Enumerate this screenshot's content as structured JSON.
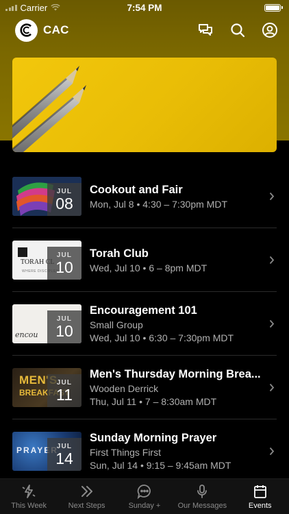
{
  "status_bar": {
    "carrier": "Carrier",
    "time": "7:54 PM"
  },
  "app_bar": {
    "title": "CAC"
  },
  "colors": {
    "header": "#7a6700",
    "hero": "#f2c70c",
    "background": "#000000"
  },
  "events": [
    {
      "title": "Cookout and Fair",
      "subtitle": "",
      "when": "Mon, Jul 8 • 4:30 – 7:30pm MDT",
      "month": "JUL",
      "day": "08"
    },
    {
      "title": "Torah Club",
      "subtitle": "",
      "when": "Wed, Jul 10 • 6 – 8pm MDT",
      "month": "JUL",
      "day": "10",
      "thumb_text": "TORAH CL",
      "thumb_sub": "WHERE DISCIPLES..."
    },
    {
      "title": "Encouragement 101",
      "subtitle": "Small Group",
      "when": "Wed, Jul 10 • 6:30 – 7:30pm MDT",
      "month": "JUL",
      "day": "10",
      "thumb_text": "encou"
    },
    {
      "title": "Men's Thursday Morning Brea...",
      "subtitle": "Wooden Derrick",
      "when": "Thu, Jul 11 • 7 – 8:30am MDT",
      "month": "JUL",
      "day": "11",
      "thumb_text": "MEN'S",
      "thumb_sub": "BREAKFAST"
    },
    {
      "title": "Sunday Morning Prayer",
      "subtitle": "First Things First",
      "when": "Sun, Jul 14 • 9:15 – 9:45am MDT",
      "month": "JUL",
      "day": "14",
      "thumb_text": "PRAYER"
    }
  ],
  "tabs": [
    {
      "label": "This Week",
      "icon": "lightning-icon"
    },
    {
      "label": "Next Steps",
      "icon": "chevrons-right-icon"
    },
    {
      "label": "Sunday +",
      "icon": "chat-bubble-icon"
    },
    {
      "label": "Our Messages",
      "icon": "microphone-icon"
    },
    {
      "label": "Events",
      "icon": "calendar-icon",
      "active": true
    }
  ]
}
